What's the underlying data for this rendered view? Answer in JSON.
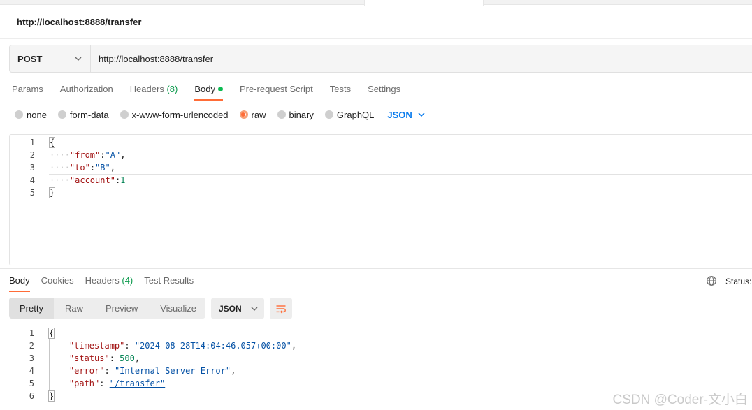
{
  "request": {
    "title": "http://localhost:8888/transfer",
    "method": "POST",
    "url": "http://localhost:8888/transfer"
  },
  "request_tabs": {
    "params": "Params",
    "authorization": "Authorization",
    "headers": "Headers",
    "headers_count": "(8)",
    "body": "Body",
    "pre_request": "Pre-request Script",
    "tests": "Tests",
    "settings": "Settings"
  },
  "body_types": {
    "none": "none",
    "form_data": "form-data",
    "urlencoded": "x-www-form-urlencoded",
    "raw": "raw",
    "binary": "binary",
    "graphql": "GraphQL",
    "format": "JSON"
  },
  "request_body": {
    "line_numbers": [
      "1",
      "2",
      "3",
      "4",
      "5"
    ],
    "open_brace": "{",
    "close_brace": "}",
    "from_key": "\"from\"",
    "from_value": "\"A\"",
    "to_key": "\"to\"",
    "to_value": "\"B\"",
    "account_key": "\"account\"",
    "account_value": "1"
  },
  "response_tabs": {
    "body": "Body",
    "cookies": "Cookies",
    "headers": "Headers",
    "headers_count": "(4)",
    "test_results": "Test Results",
    "status_label": "Status:"
  },
  "response_view": {
    "pretty": "Pretty",
    "raw": "Raw",
    "preview": "Preview",
    "visualize": "Visualize",
    "format": "JSON"
  },
  "response_body": {
    "line_numbers": [
      "1",
      "2",
      "3",
      "4",
      "5",
      "6"
    ],
    "open_brace": "{",
    "close_brace": "}",
    "timestamp_key": "\"timestamp\"",
    "timestamp_value": "\"2024-08-28T14:04:46.057+00:00\"",
    "status_key": "\"status\"",
    "status_value": "500",
    "error_key": "\"error\"",
    "error_value": "\"Internal Server Error\"",
    "path_key": "\"path\"",
    "path_value": "\"/transfer\""
  },
  "watermark": "CSDN @Coder-文小白",
  "colors": {
    "accent": "#ff6c37",
    "green": "#0cbb52",
    "link": "#097bed"
  }
}
